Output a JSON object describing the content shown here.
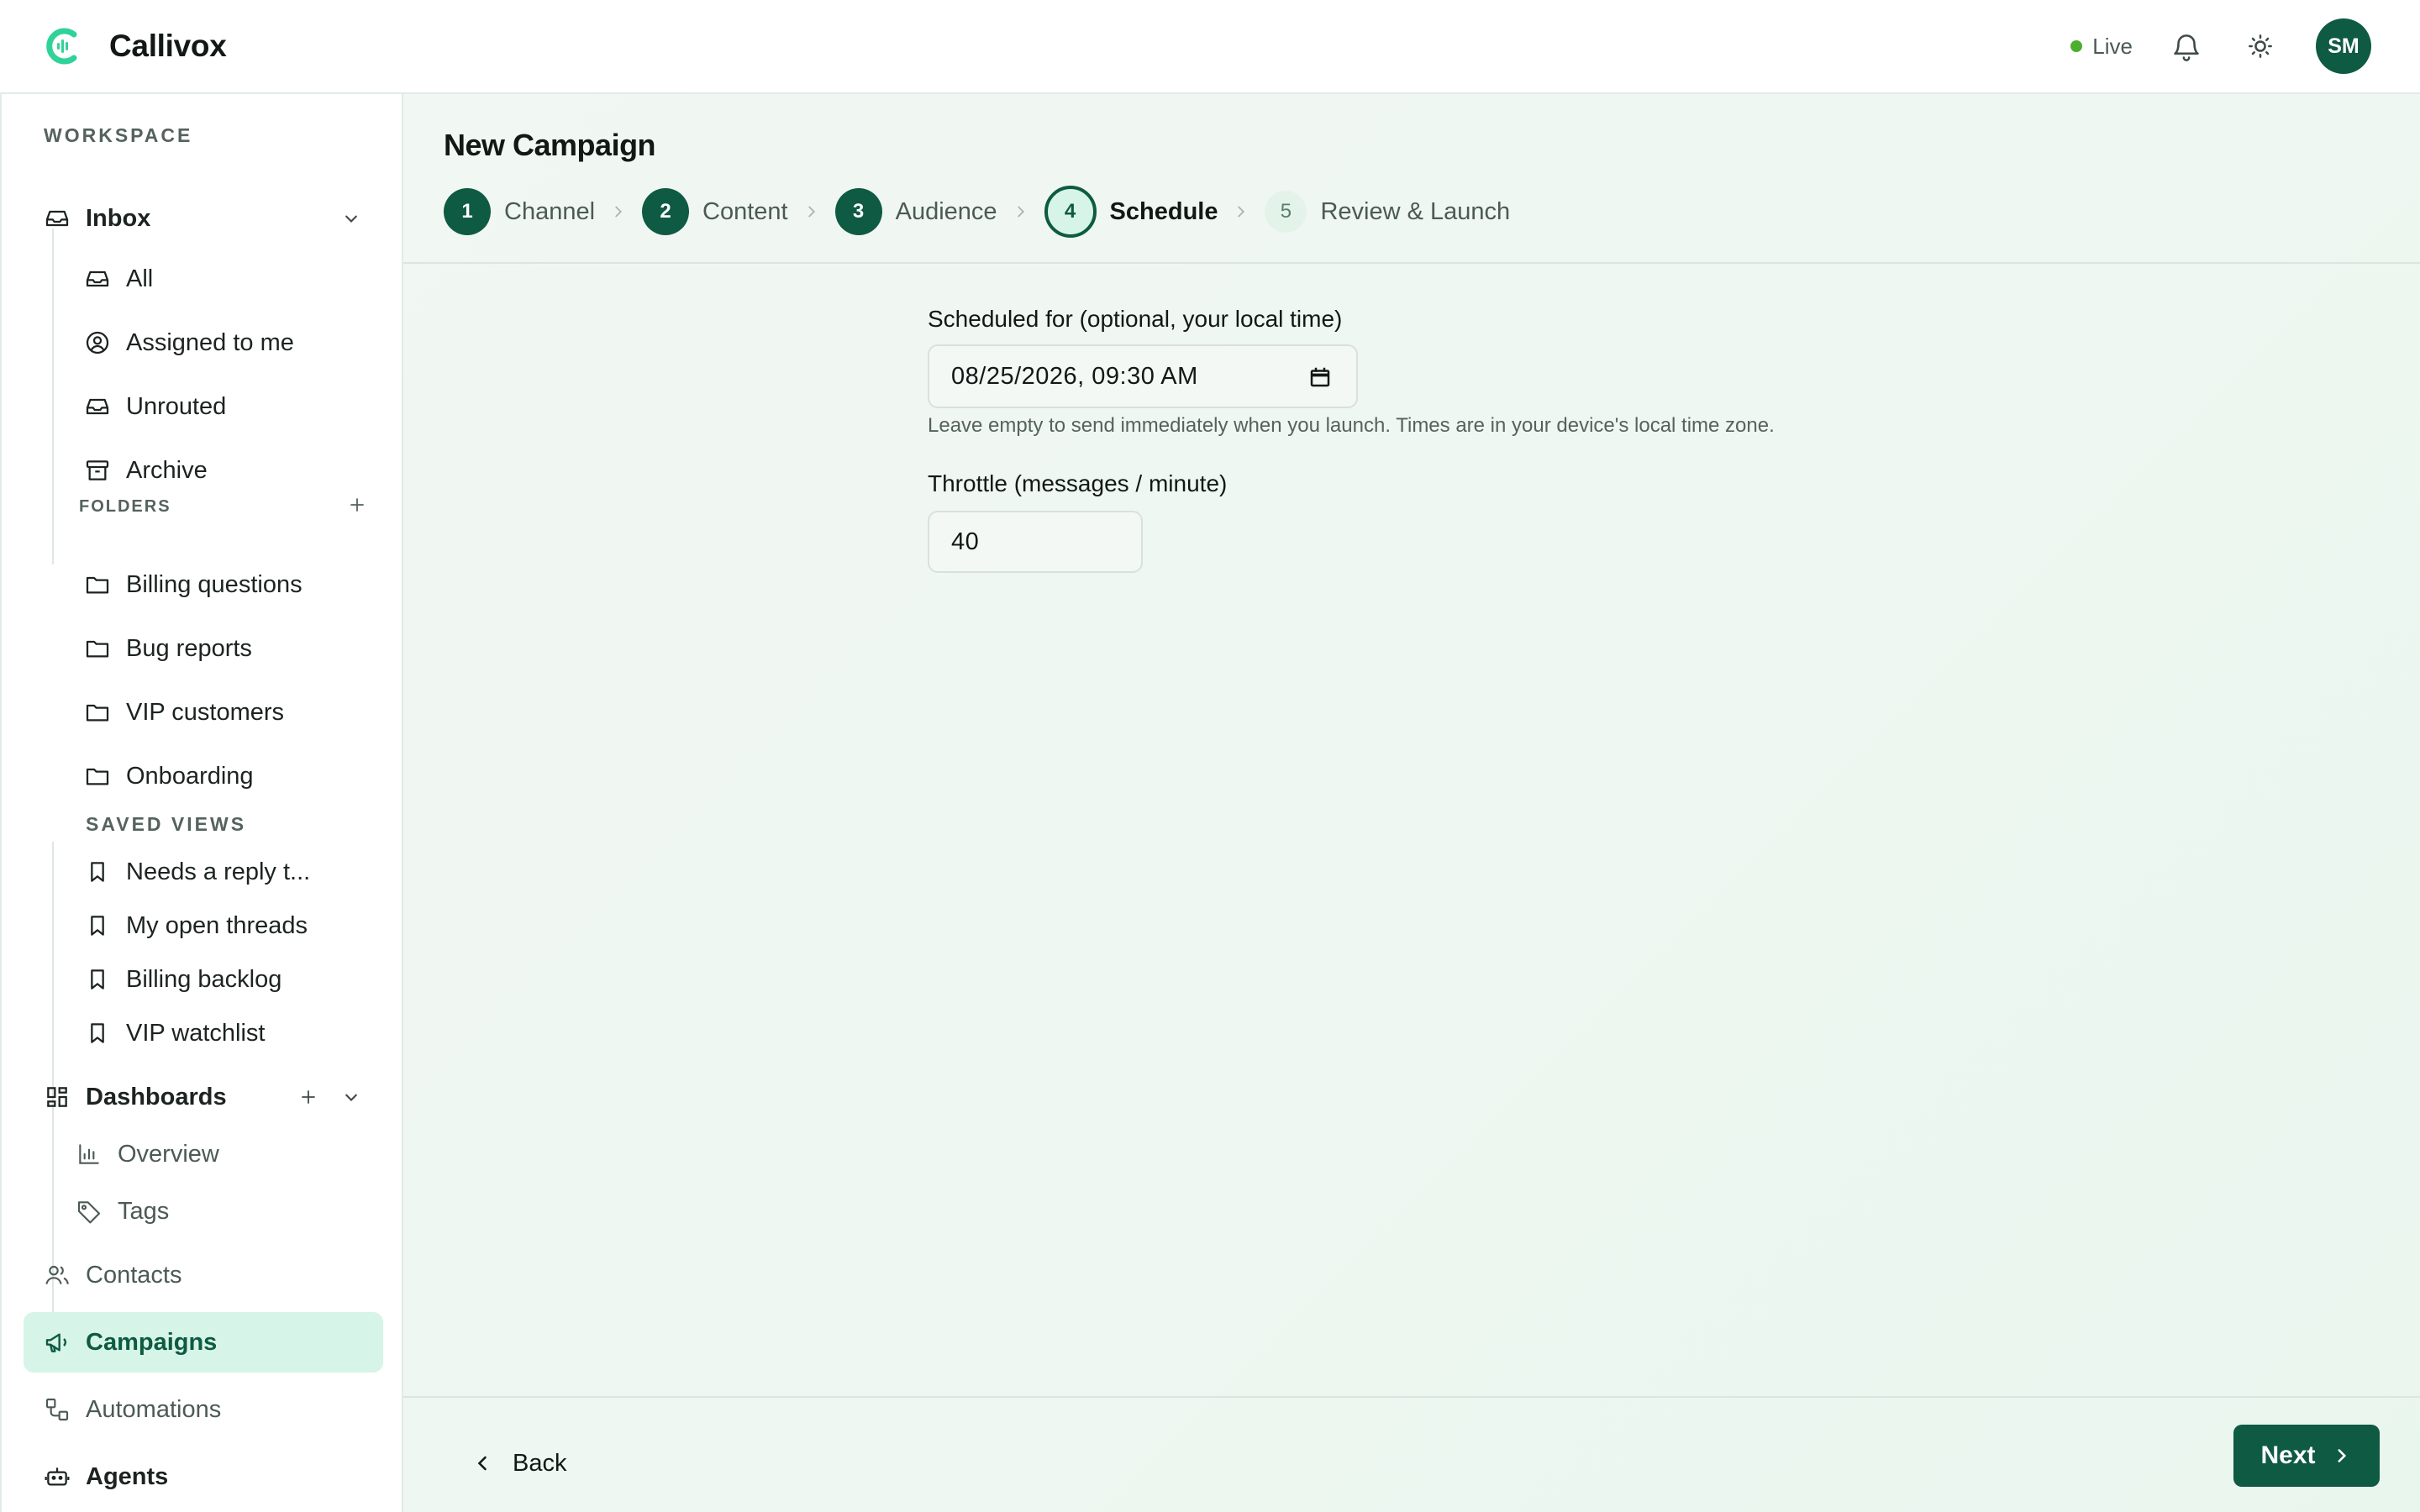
{
  "app": {
    "name": "Callivox"
  },
  "topbar": {
    "status_label": "Live",
    "status_color": "#4caf2e",
    "avatar_initials": "SM",
    "icons": [
      "bell-icon",
      "sun-icon"
    ]
  },
  "sidebar": {
    "workspace_label": "WORKSPACE",
    "inbox": {
      "label": "Inbox",
      "items": [
        {
          "label": "All",
          "icon": "inbox-icon"
        },
        {
          "label": "Assigned to me",
          "icon": "user-circle-icon"
        },
        {
          "label": "Unrouted",
          "icon": "inbox-icon"
        },
        {
          "label": "Archive",
          "icon": "archive-icon"
        }
      ]
    },
    "folders": {
      "label": "FOLDERS",
      "items": [
        {
          "label": "Billing questions"
        },
        {
          "label": "Bug reports"
        },
        {
          "label": "VIP customers"
        },
        {
          "label": "Onboarding"
        }
      ]
    },
    "saved_views": {
      "label": "SAVED VIEWS",
      "items": [
        {
          "label": "Needs a reply t..."
        },
        {
          "label": "My open threads"
        },
        {
          "label": "Billing backlog"
        },
        {
          "label": "VIP watchlist"
        }
      ]
    },
    "dashboards": {
      "label": "Dashboards",
      "items": [
        {
          "label": "Overview",
          "icon": "bar-chart-icon"
        },
        {
          "label": "Tags",
          "icon": "tag-icon"
        }
      ]
    },
    "nav": [
      {
        "label": "Contacts",
        "icon": "users-icon"
      },
      {
        "label": "Campaigns",
        "icon": "megaphone-icon",
        "active": true
      },
      {
        "label": "Automations",
        "icon": "workflow-icon"
      },
      {
        "label": "Agents",
        "icon": "bot-icon"
      }
    ]
  },
  "main": {
    "title": "New Campaign",
    "steps": [
      {
        "num": "1",
        "label": "Channel",
        "state": "done"
      },
      {
        "num": "2",
        "label": "Content",
        "state": "done"
      },
      {
        "num": "3",
        "label": "Audience",
        "state": "done"
      },
      {
        "num": "4",
        "label": "Schedule",
        "state": "current"
      },
      {
        "num": "5",
        "label": "Review & Launch",
        "state": "upcoming"
      }
    ],
    "schedule": {
      "label": "Scheduled for (optional, your local time)",
      "value": "08/25/2026, 09:30 AM",
      "help": "Leave empty to send immediately when you launch. Times are in your device's local time zone."
    },
    "throttle": {
      "label": "Throttle (messages / minute)",
      "value": "40"
    },
    "back_label": "Back",
    "next_label": "Next"
  },
  "colors": {
    "brand": "#0e5a43",
    "active_bg": "#d6f5e8",
    "logo_accent": "#2fd39a"
  }
}
